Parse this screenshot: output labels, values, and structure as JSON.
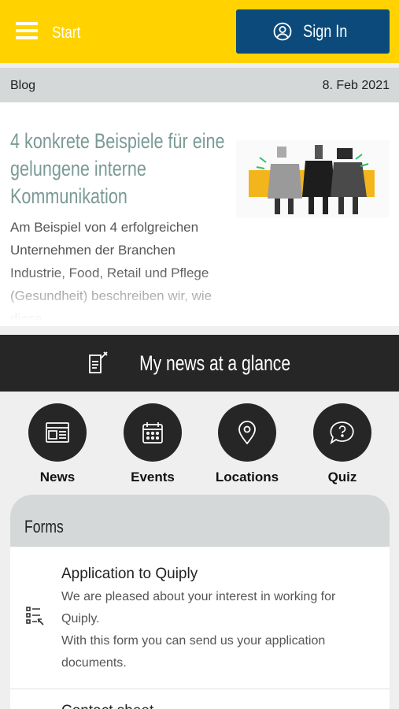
{
  "header": {
    "start_label": "Start",
    "signin_label": "Sign In",
    "accent_color": "#ffd200",
    "signin_color": "#0b4a7a"
  },
  "blog": {
    "section_label": "Blog",
    "date": "8. Feb 2021",
    "article_title": "4 konkrete Beispiele für eine gelungene interne Kommunikation",
    "article_excerpt": "Am Beispiel von 4 erfolgreichen Unternehmen der Branchen Industrie, Food, Retail und Pflege  (Gesundheit) beschreiben wir, wie diese ..."
  },
  "glance": {
    "label": "My news at a glance",
    "icon": "news-edit-icon"
  },
  "quick_nav": [
    {
      "label": "News",
      "icon": "news-icon"
    },
    {
      "label": "Events",
      "icon": "calendar-icon"
    },
    {
      "label": "Locations",
      "icon": "location-pin-icon"
    },
    {
      "label": "Quiz",
      "icon": "question-bubble-icon"
    }
  ],
  "forms": {
    "title": "Forms",
    "items": [
      {
        "title": "Application to Quiply",
        "description": "We are pleased about your interest in working for Quiply.\nWith this form you can send us your application documents.",
        "icon": "form-checklist-icon"
      },
      {
        "title": "Contact sheet"
      }
    ]
  }
}
